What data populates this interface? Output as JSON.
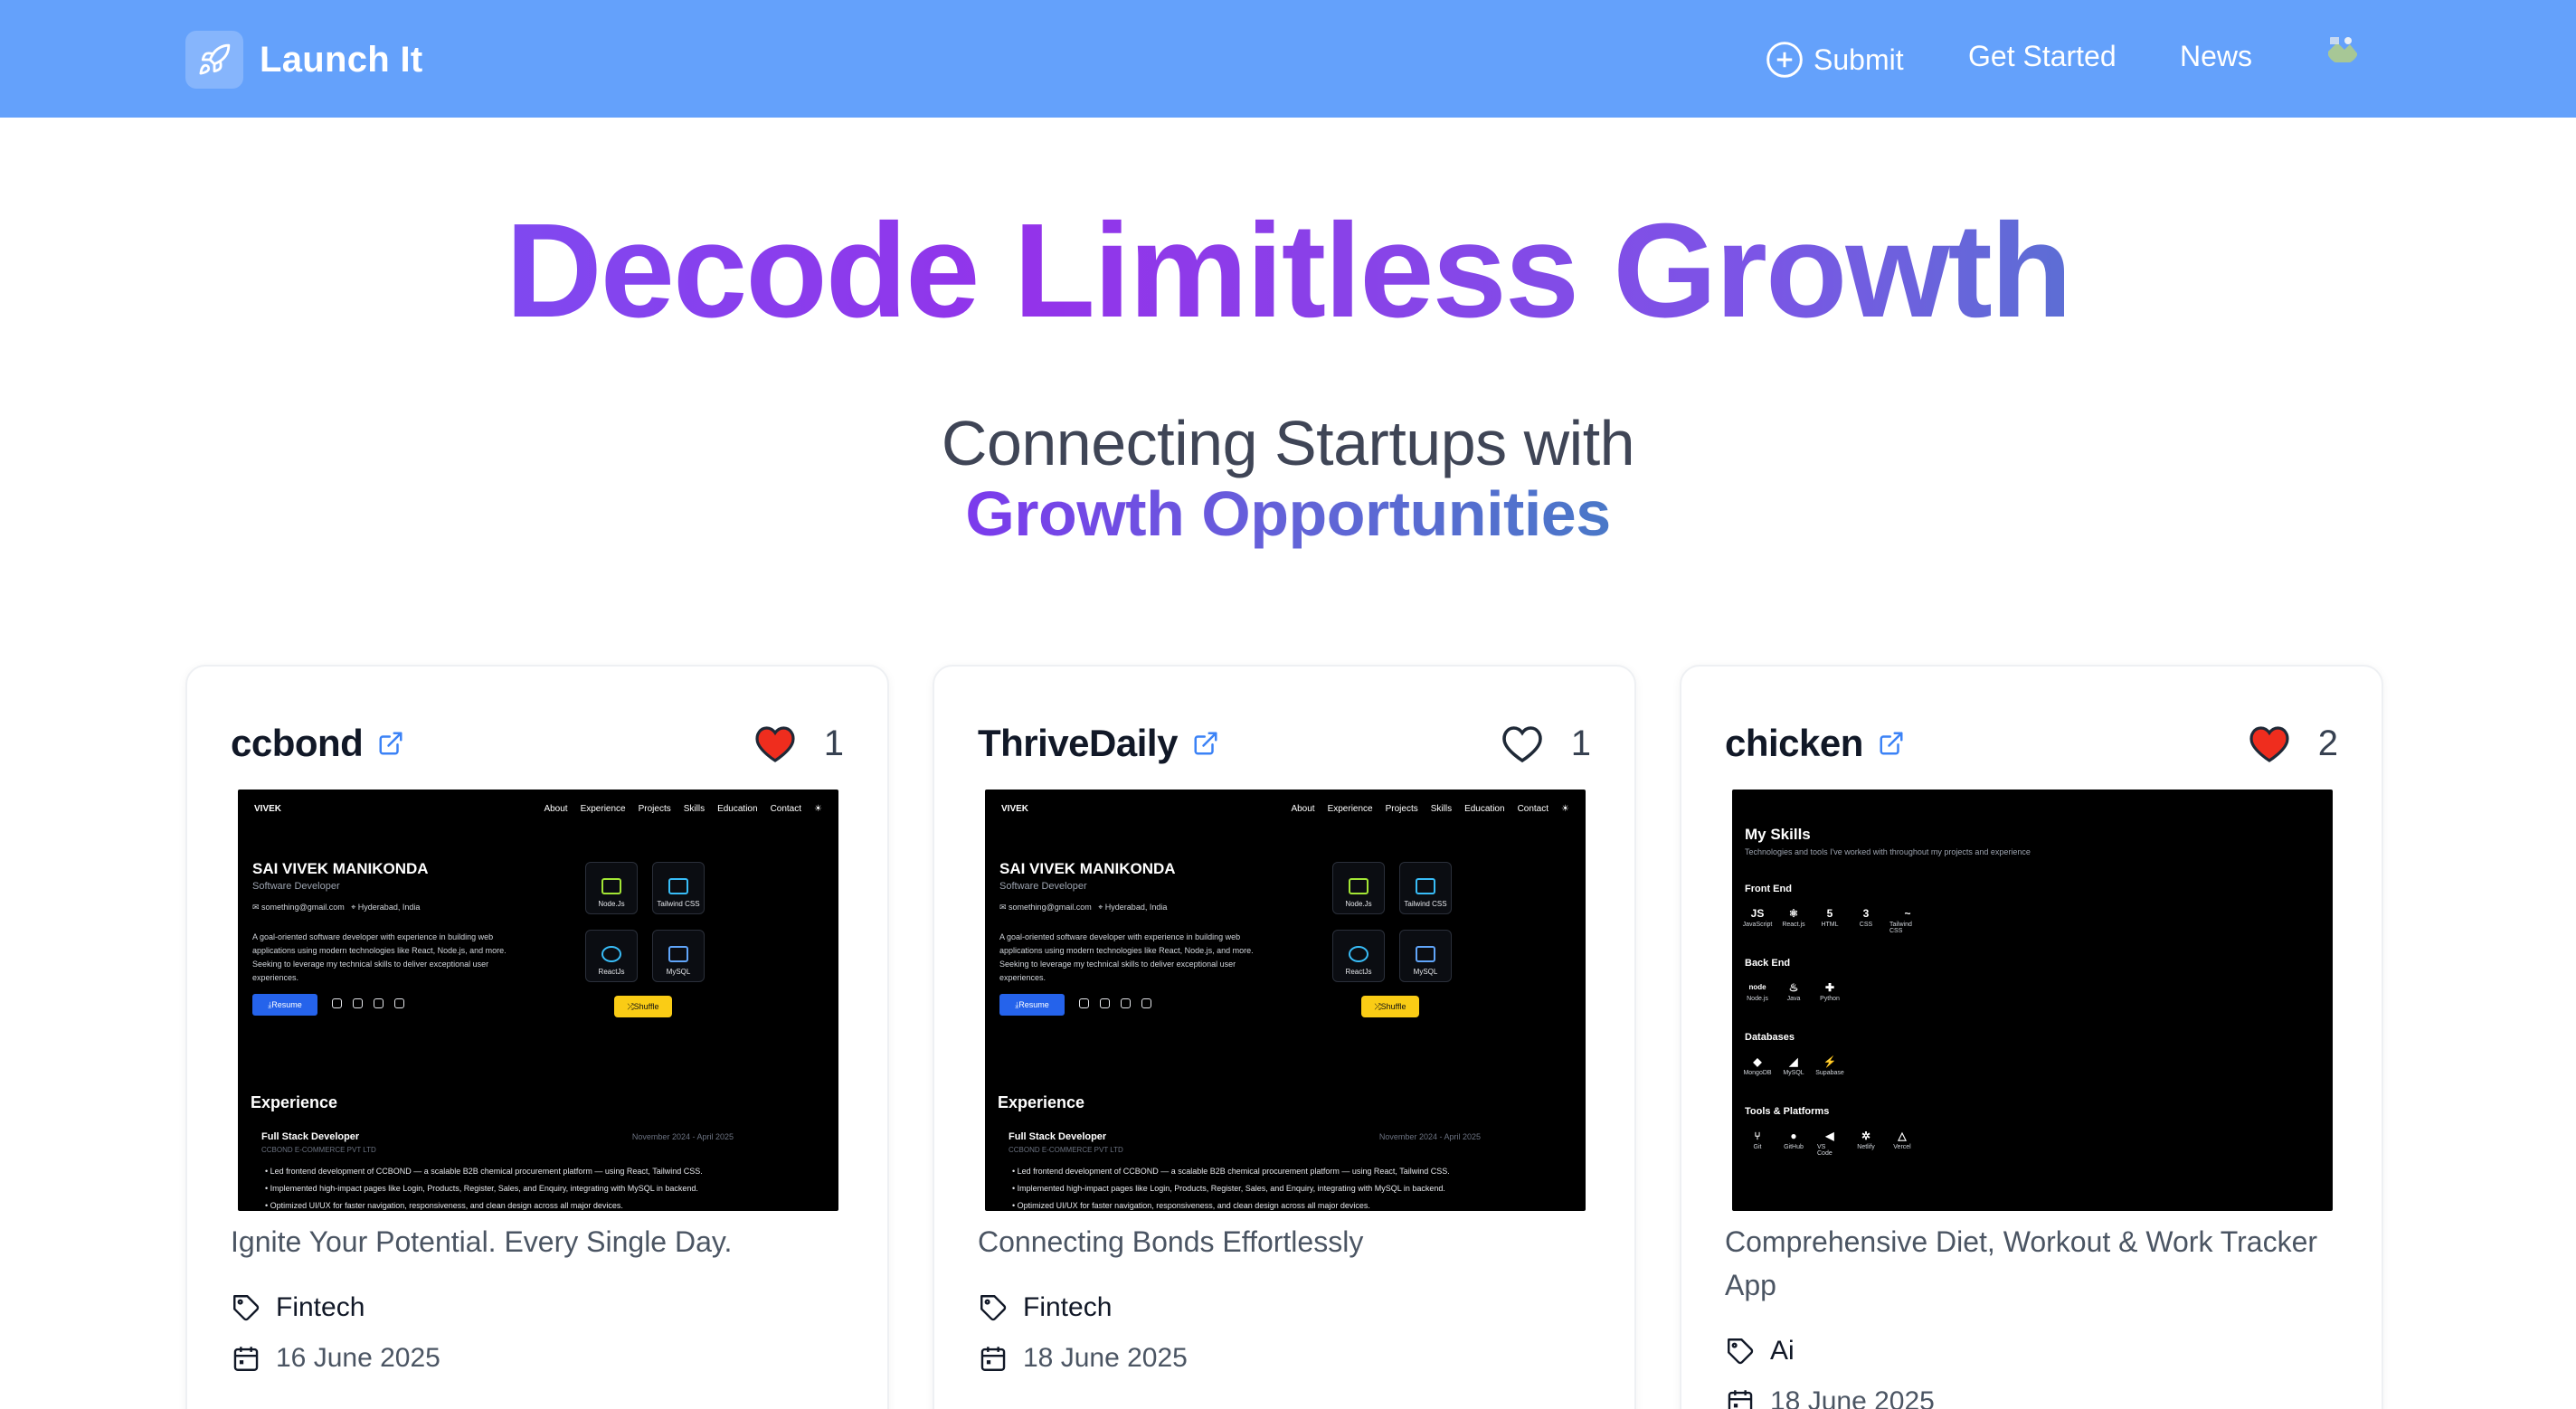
{
  "nav": {
    "brand": "Launch It",
    "submit": "Submit",
    "get_started": "Get Started",
    "news": "News"
  },
  "hero": {
    "title": "Decode Limitless Growth",
    "subtitle_line1": "Connecting Startups with",
    "subtitle_line2": "Growth Opportunities"
  },
  "colors": {
    "navbar": "#64a1fb",
    "heart_filled": "#ef2d1e"
  },
  "cards": [
    {
      "name": "ccbond",
      "likes": "1",
      "liked": true,
      "tagline": "Ignite Your Potential. Every Single Day.",
      "category": "Fintech",
      "date": "16 June 2025",
      "shot": {
        "logo": "VIVEK",
        "nav": [
          "About",
          "Experience",
          "Projects",
          "Skills",
          "Education",
          "Contact"
        ],
        "name": "SAI VIVEK MANIKONDA",
        "role": "Software Developer",
        "email": "something@gmail.com",
        "location": "Hyderabad, India",
        "bio": "A goal-oriented software developer with experience in building web applications using modern technologies like React, Node.js, and more. Seeking to leverage my technical skills to deliver exceptional user experiences.",
        "resume": "Resume",
        "tiles": [
          "Node.Js",
          "Tailwind CSS",
          "ReactJs",
          "MySQL"
        ],
        "shuffle": "Shuffle",
        "exp_heading": "Experience",
        "exp_role": "Full Stack Developer",
        "exp_date": "November 2024 - April 2025",
        "exp_company": "CCBOND E-COMMERCE PVT LTD",
        "exp_points": [
          "Led frontend development of CCBOND — a scalable B2B chemical procurement platform — using React, Tailwind CSS.",
          "Implemented high-impact pages like Login, Products, Register, Sales, and Enquiry, integrating with MySQL in backend.",
          "Optimized UI/UX for faster navigation, responsiveness, and clean design across all major devices."
        ]
      }
    },
    {
      "name": "ThriveDaily",
      "likes": "1",
      "liked": false,
      "tagline": "Connecting Bonds Effortlessly",
      "category": "Fintech",
      "date": "18 June 2025",
      "shot": {
        "logo": "VIVEK",
        "nav": [
          "About",
          "Experience",
          "Projects",
          "Skills",
          "Education",
          "Contact"
        ],
        "name": "SAI VIVEK MANIKONDA",
        "role": "Software Developer",
        "email": "something@gmail.com",
        "location": "Hyderabad, India",
        "bio": "A goal-oriented software developer with experience in building web applications using modern technologies like React, Node.js, and more. Seeking to leverage my technical skills to deliver exceptional user experiences.",
        "resume": "Resume",
        "tiles": [
          "Node.Js",
          "Tailwind CSS",
          "ReactJs",
          "MySQL"
        ],
        "shuffle": "Shuffle",
        "exp_heading": "Experience",
        "exp_role": "Full Stack Developer",
        "exp_date": "November 2024 - April 2025",
        "exp_company": "CCBOND E-COMMERCE PVT LTD",
        "exp_points": [
          "Led frontend development of CCBOND — a scalable B2B chemical procurement platform — using React, Tailwind CSS.",
          "Implemented high-impact pages like Login, Products, Register, Sales, and Enquiry, integrating with MySQL in backend.",
          "Optimized UI/UX for faster navigation, responsiveness, and clean design across all major devices."
        ]
      }
    },
    {
      "name": "chicken",
      "likes": "2",
      "liked": true,
      "tagline": "Comprehensive Diet, Workout & Work Tracker App",
      "category": "Ai",
      "date": "18 June 2025",
      "shot": {
        "title": "My Skills",
        "subtitle": "Technologies and tools I've worked with throughout my projects and experience",
        "sections": [
          {
            "name": "Front End",
            "items": [
              [
                "JS",
                "JavaScript"
              ],
              [
                "⚛",
                "React.js"
              ],
              [
                "5",
                "HTML"
              ],
              [
                "3",
                "CSS"
              ],
              [
                "~",
                "Tailwind CSS"
              ]
            ]
          },
          {
            "name": "Back End",
            "items": [
              [
                "node",
                "Node.js"
              ],
              [
                "♨",
                "Java"
              ],
              [
                "✚",
                "Python"
              ]
            ]
          },
          {
            "name": "Databases",
            "items": [
              [
                "◆",
                "MongoDB"
              ],
              [
                "◢",
                "MySQL"
              ],
              [
                "⚡",
                "Supabase"
              ]
            ]
          },
          {
            "name": "Tools & Platforms",
            "items": [
              [
                "⑂",
                "Git"
              ],
              [
                "●",
                "GitHub"
              ],
              [
                "◀",
                "VS Code"
              ],
              [
                "✲",
                "Netlify"
              ],
              [
                "△",
                "Vercel"
              ]
            ]
          }
        ]
      }
    }
  ]
}
